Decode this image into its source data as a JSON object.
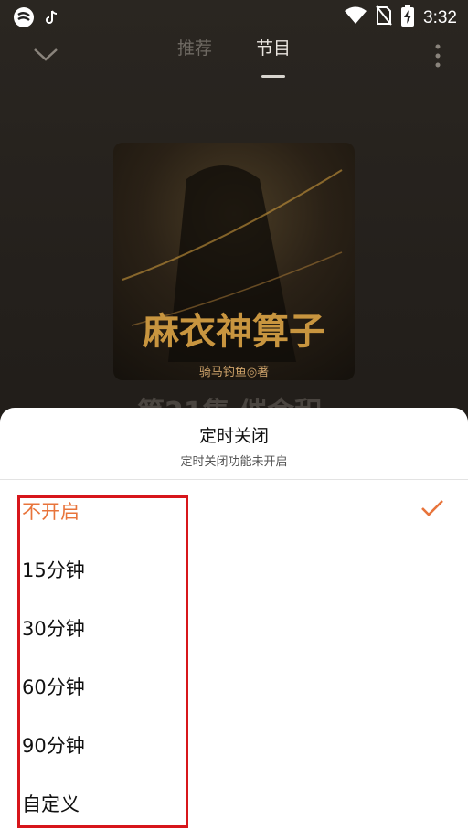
{
  "status_bar": {
    "time": "3:32",
    "icons": [
      "app-logo-icon",
      "tiktok-icon",
      "wifi-icon",
      "no-sim-icon",
      "battery-charging-icon"
    ]
  },
  "header": {
    "tabs": [
      {
        "label": "推荐",
        "active": false
      },
      {
        "label": "节目",
        "active": true
      }
    ]
  },
  "player": {
    "cover_title": "麻衣神算子",
    "cover_author": "骑马钓鱼◎著",
    "episode_title_partial": "第21集 催命积"
  },
  "sleep_timer": {
    "title": "定时关闭",
    "subtitle": "定时关闭功能未开启",
    "options": [
      {
        "label": "不开启",
        "selected": true
      },
      {
        "label": "15分钟",
        "selected": false
      },
      {
        "label": "30分钟",
        "selected": false
      },
      {
        "label": "60分钟",
        "selected": false
      },
      {
        "label": "90分钟",
        "selected": false
      },
      {
        "label": "自定义",
        "selected": false
      }
    ]
  },
  "colors": {
    "accent": "#e8743b",
    "highlight_box": "#d7161b"
  }
}
